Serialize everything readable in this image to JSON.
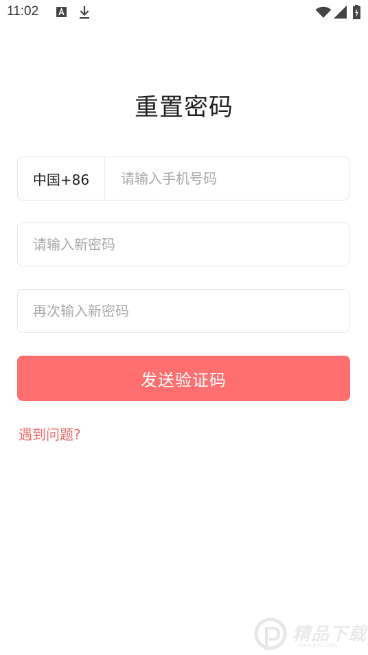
{
  "status_bar": {
    "time": "11:02",
    "icons": [
      "font-icon",
      "download-icon",
      "wifi-icon",
      "signal-icon",
      "battery-icon"
    ]
  },
  "title": "重置密码",
  "phone_field": {
    "country_code": "中国+86",
    "placeholder": "请输入手机号码",
    "value": ""
  },
  "password_field": {
    "placeholder": "请输入新密码",
    "value": ""
  },
  "confirm_password_field": {
    "placeholder": "再次输入新密码",
    "value": ""
  },
  "send_button": {
    "label": "发送验证码"
  },
  "help_link": {
    "label": "遇到问题?"
  },
  "watermark": {
    "text": "精品下载",
    "url": "www.jpxz.com"
  },
  "colors": {
    "accent": "#ff6f6f",
    "link": "#ee6b6b",
    "border": "#e6e6e6",
    "placeholder": "#a9a9a9"
  }
}
